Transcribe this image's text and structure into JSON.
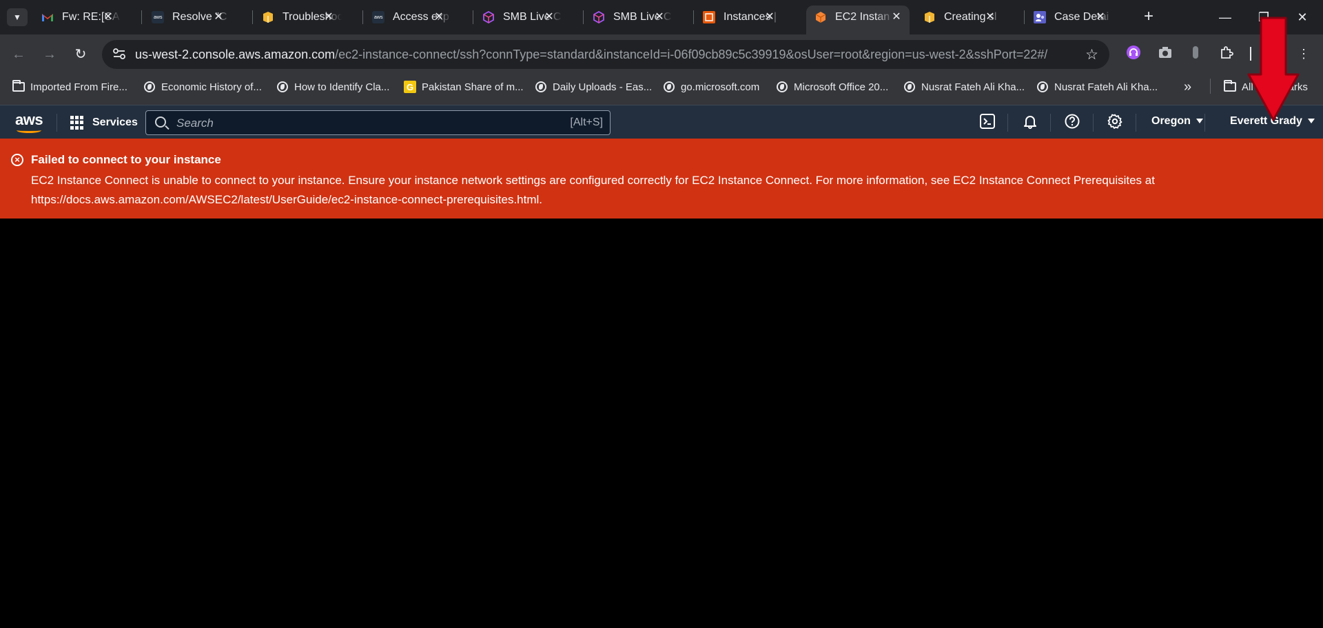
{
  "browser": {
    "tabs": [
      {
        "title": "Fw: RE:[CA",
        "icon": "gmail-icon"
      },
      {
        "title": "Resolve \"C",
        "icon": "aws-icon"
      },
      {
        "title": "Troubleshoo",
        "icon": "box-icon"
      },
      {
        "title": "Access exp",
        "icon": "aws-icon"
      },
      {
        "title": "SMB Live C",
        "icon": "cube-icon"
      },
      {
        "title": "SMB Live C",
        "icon": "cube-icon"
      },
      {
        "title": "Instances |",
        "icon": "ec2-icon"
      },
      {
        "title": "EC2 Instan",
        "icon": "ec2-icon",
        "active": true
      },
      {
        "title": "Creating sl",
        "icon": "box-icon"
      },
      {
        "title": "Case Detai",
        "icon": "case-icon"
      }
    ],
    "url_host": "us-west-2.console.aws.amazon.com",
    "url_path": "/ec2-instance-connect/ssh?connType=standard&instanceId=i-06f09cb89c5c39919&osUser=root&region=us-west-2&sshPort=22#/",
    "bookmarks": [
      {
        "label": "Imported From Fire...",
        "icon": "folder-icon"
      },
      {
        "label": "Economic History of...",
        "icon": "globe-icon"
      },
      {
        "label": "How to Identify Cla...",
        "icon": "globe-icon"
      },
      {
        "label": "Pakistan Share of m...",
        "icon": "g-icon"
      },
      {
        "label": "Daily Uploads - Eas...",
        "icon": "globe-icon"
      },
      {
        "label": "go.microsoft.com",
        "icon": "globe-icon"
      },
      {
        "label": "Microsoft Office 20...",
        "icon": "globe-icon"
      },
      {
        "label": "Nusrat Fateh Ali Kha...",
        "icon": "globe-icon"
      },
      {
        "label": "Nusrat Fateh Ali Kha...",
        "icon": "globe-icon"
      }
    ],
    "bookmarks_overflow": "»",
    "all_bookmarks": "All Bookmarks"
  },
  "aws": {
    "logo": "aws",
    "services_label": "Services",
    "search_placeholder": "Search",
    "search_shortcut": "[Alt+S]",
    "region": "Oregon",
    "user": "Everett Grady"
  },
  "error": {
    "title": "Failed to connect to your instance",
    "message": "EC2 Instance Connect is unable to connect to your instance. Ensure your instance network settings are configured correctly for EC2 Instance Connect. For more information, see EC2 Instance Connect Prerequisites at https://docs.aws.amazon.com/AWSEC2/latest/UserGuide/ec2-instance-connect-prerequisites.html."
  },
  "colors": {
    "error_banner": "#d13212",
    "aws_nav": "#232f3e",
    "annotation_arrow": "#e3061d"
  }
}
